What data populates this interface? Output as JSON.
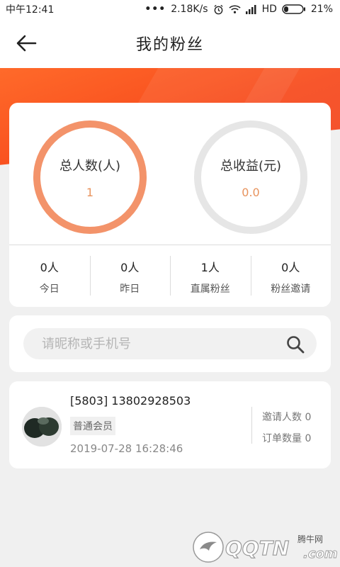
{
  "status_bar": {
    "time": "中午12:41",
    "network_speed": "2.18K/s",
    "network_type": "HD",
    "battery": "21%",
    "icons": [
      "alarm-icon",
      "wifi-icon",
      "signal-icon",
      "battery-icon"
    ]
  },
  "header": {
    "title": "我的粉丝",
    "back_icon": "back-arrow-icon"
  },
  "summary": {
    "total_people_label": "总人数(人)",
    "total_people_value": "1",
    "total_income_label": "总收益(元)",
    "total_income_value": "0.0"
  },
  "stats": [
    {
      "value": "0人",
      "label": "今日"
    },
    {
      "value": "0人",
      "label": "昨日"
    },
    {
      "value": "1人",
      "label": "直属粉丝"
    },
    {
      "value": "0人",
      "label": "粉丝邀请"
    }
  ],
  "search": {
    "placeholder": "请昵称或手机号",
    "value": "",
    "icon": "search-icon"
  },
  "fans": [
    {
      "name": "[5803] 13802928503",
      "level": "普通会员",
      "date": "2019-07-28 16:28:46",
      "invite_count": "邀请人数 0",
      "order_count": "订单数量 0"
    }
  ],
  "watermark": {
    "brand": "QQTN",
    "site": "腾牛网",
    "domain": ".com"
  },
  "colors": {
    "accent": "#f74a1c",
    "ring_orange": "#f3936a",
    "ring_gray": "#e6e6e6",
    "value_orange": "#e8935d"
  }
}
